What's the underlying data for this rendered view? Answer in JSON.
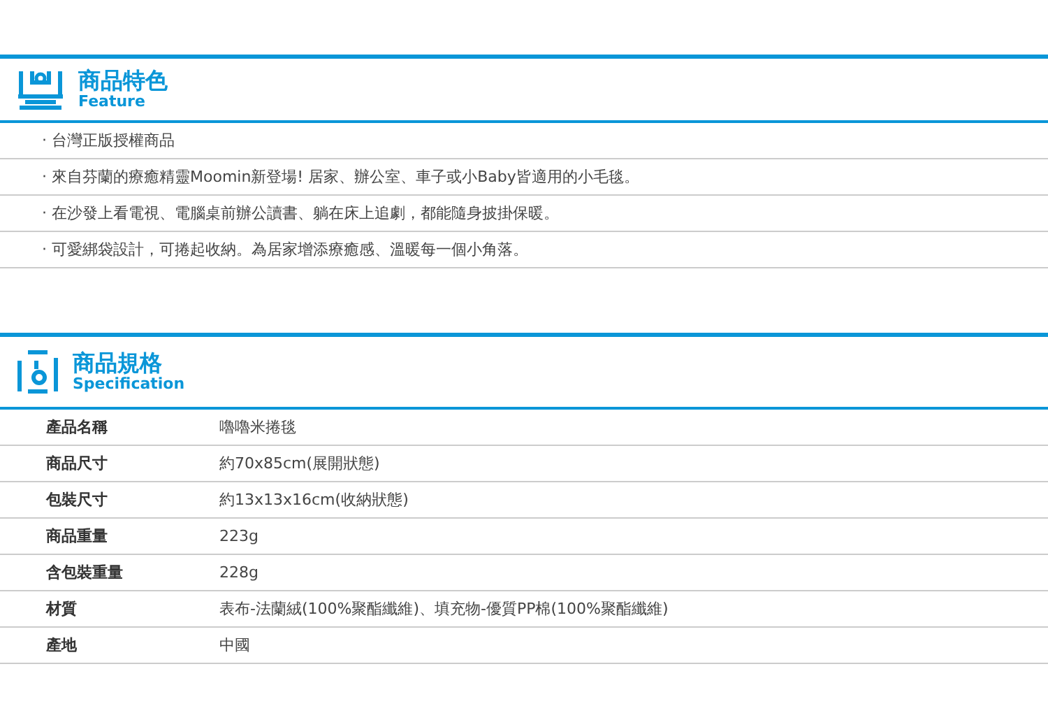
{
  "feature": {
    "title": "商品特色",
    "subtitle": "Feature",
    "items": [
      "‧ 台灣正版授權商品",
      "‧ 來自芬蘭的療癒精靈Moomin新登場! 居家、辦公室、車子或小Baby皆適用的小毛毯。",
      "‧ 在沙發上看電視、電腦桌前辦公讀書、躺在床上追劇，都能隨身披掛保暖。",
      "‧ 可愛綁袋設計，可捲起收納。為居家增添療癒感、溫暖每一個小角落。"
    ]
  },
  "specification": {
    "title": "商品規格",
    "subtitle": "Specification",
    "rows": [
      {
        "label": "產品名稱",
        "value": "嚕嚕米捲毯"
      },
      {
        "label": "商品尺寸",
        "value": "約70x85cm(展開狀態)"
      },
      {
        "label": "包裝尺寸",
        "value": "約13x13x16cm(收納狀態)"
      },
      {
        "label": "商品重量",
        "value": "223g"
      },
      {
        "label": "含包裝重量",
        "value": "228g"
      },
      {
        "label": "材質",
        "value": "表布-法蘭絨(100%聚酯纖維)、填充物-優質PP棉(100%聚酯纖維)"
      },
      {
        "label": "產地",
        "value": "中國"
      }
    ]
  }
}
